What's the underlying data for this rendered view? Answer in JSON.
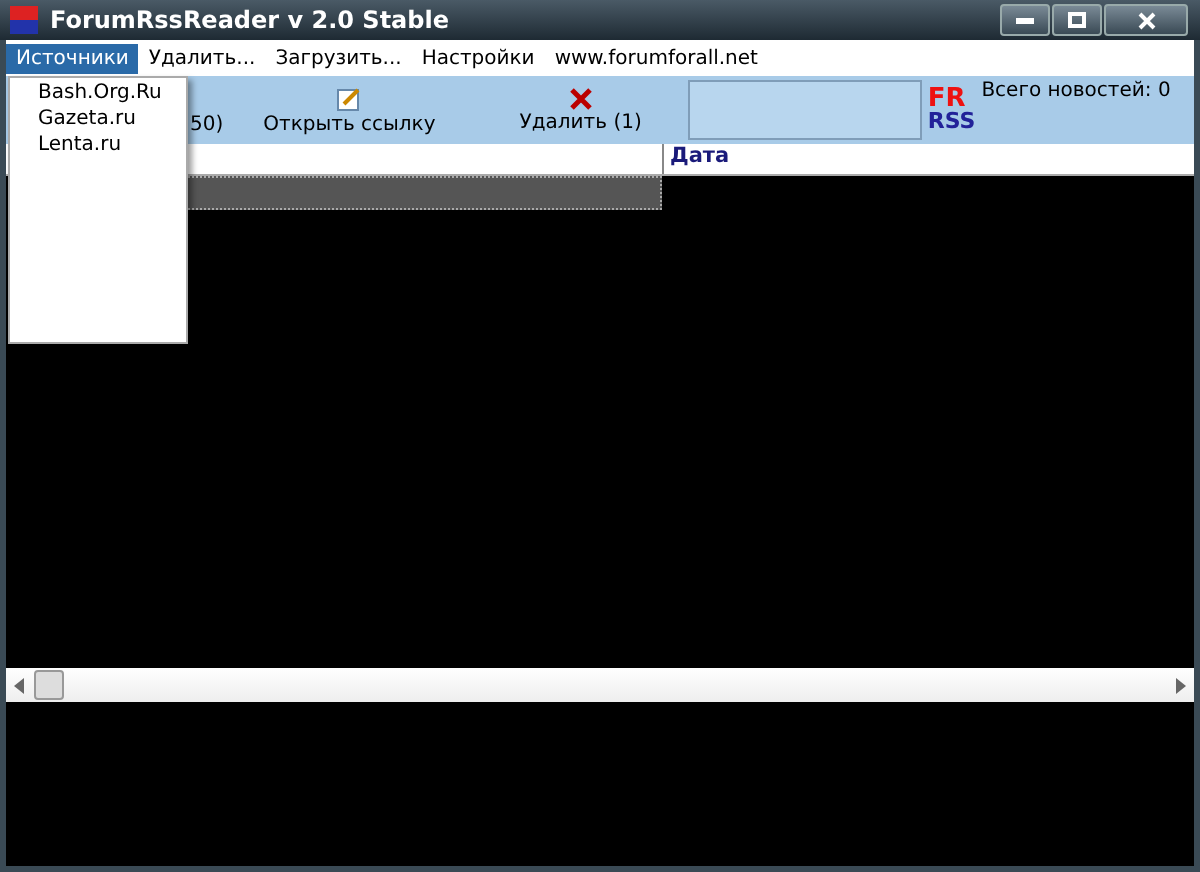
{
  "window": {
    "title": "ForumRssReader v 2.0 Stable"
  },
  "menu": [
    {
      "label": "Источники",
      "selected": true
    },
    {
      "label": "Удалить...",
      "selected": false
    },
    {
      "label": "Загрузить...",
      "selected": false
    },
    {
      "label": "Настройки",
      "selected": false
    },
    {
      "label": "www.forumforall.net",
      "selected": false
    }
  ],
  "dropdown": [
    "Bash.Org.Ru",
    "Gazeta.ru",
    "Lenta.ru"
  ],
  "toolbar": [
    {
      "label": "50)",
      "kind": "text"
    },
    {
      "label": "Открыть ссылку",
      "kind": "open"
    },
    {
      "label": "Удалить (1)",
      "kind": "delete"
    }
  ],
  "logo": {
    "top": "FR",
    "bottom": "RSS"
  },
  "total": "Всего новостей: 0",
  "table": {
    "columns": [
      "Дата"
    ]
  }
}
